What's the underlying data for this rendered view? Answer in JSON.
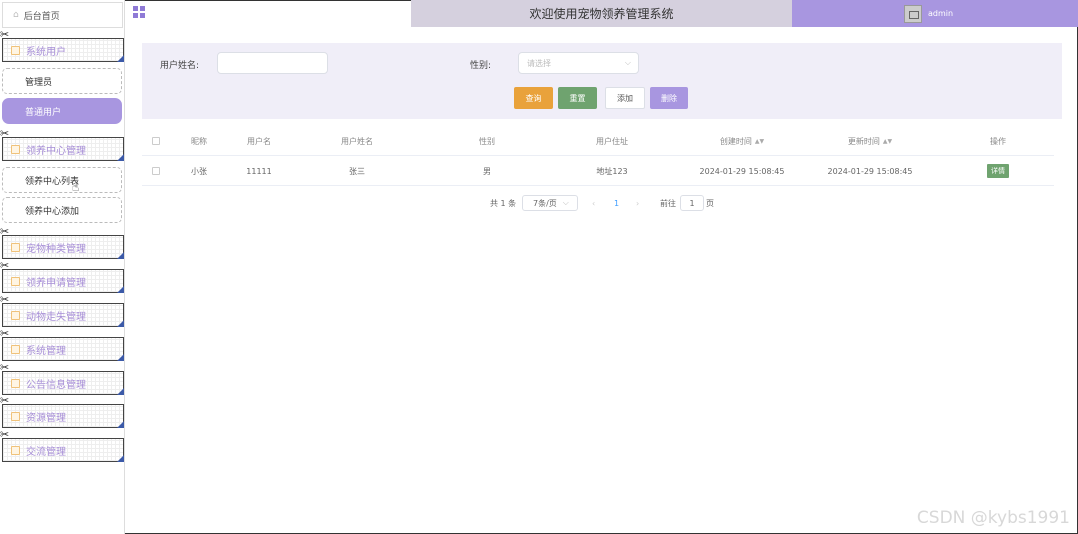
{
  "sidebar": {
    "home": "后台首页",
    "groups": [
      {
        "label": "系统用户",
        "children": [
          "管理员",
          "普通用户"
        ]
      },
      {
        "label": "领养中心管理",
        "children": [
          "领养中心列表",
          "领养中心添加"
        ]
      },
      {
        "label": "宠物种类管理"
      },
      {
        "label": "领养申请管理"
      },
      {
        "label": "动物走失管理"
      },
      {
        "label": "系统管理"
      },
      {
        "label": "公告信息管理"
      },
      {
        "label": "资源管理"
      },
      {
        "label": "交流管理"
      }
    ],
    "active_item": "普通用户"
  },
  "header": {
    "title": "欢迎使用宠物领养管理系统",
    "user": "admin"
  },
  "search": {
    "name_label": "用户姓名:",
    "name_value": "",
    "gender_label": "性别:",
    "gender_placeholder": "请选择",
    "buttons": {
      "query": "查询",
      "reset": "重置",
      "add": "添加",
      "delete": "删除"
    }
  },
  "table": {
    "headers": [
      "",
      "昵称",
      "用户名",
      "用户姓名",
      "性别",
      "用户住址",
      "创建时间",
      "更新时间",
      "操作"
    ],
    "rows": [
      {
        "nickname": "小张",
        "username": "11111",
        "realname": "张三",
        "gender": "男",
        "address": "地址123",
        "created": "2024-01-29 15:08:45",
        "updated": "2024-01-29 15:08:45",
        "action": "详情"
      }
    ]
  },
  "pagination": {
    "total": "共 1 条",
    "page_size": "7条/页",
    "current_page": "1",
    "goto_prefix": "前往",
    "goto_value": "1",
    "goto_suffix": "页"
  },
  "colors": {
    "accent": "#a896e0",
    "query": "#e9a23b",
    "reset": "#6fa36f",
    "delete": "#a896e0"
  },
  "watermark": "CSDN @kybs1991"
}
